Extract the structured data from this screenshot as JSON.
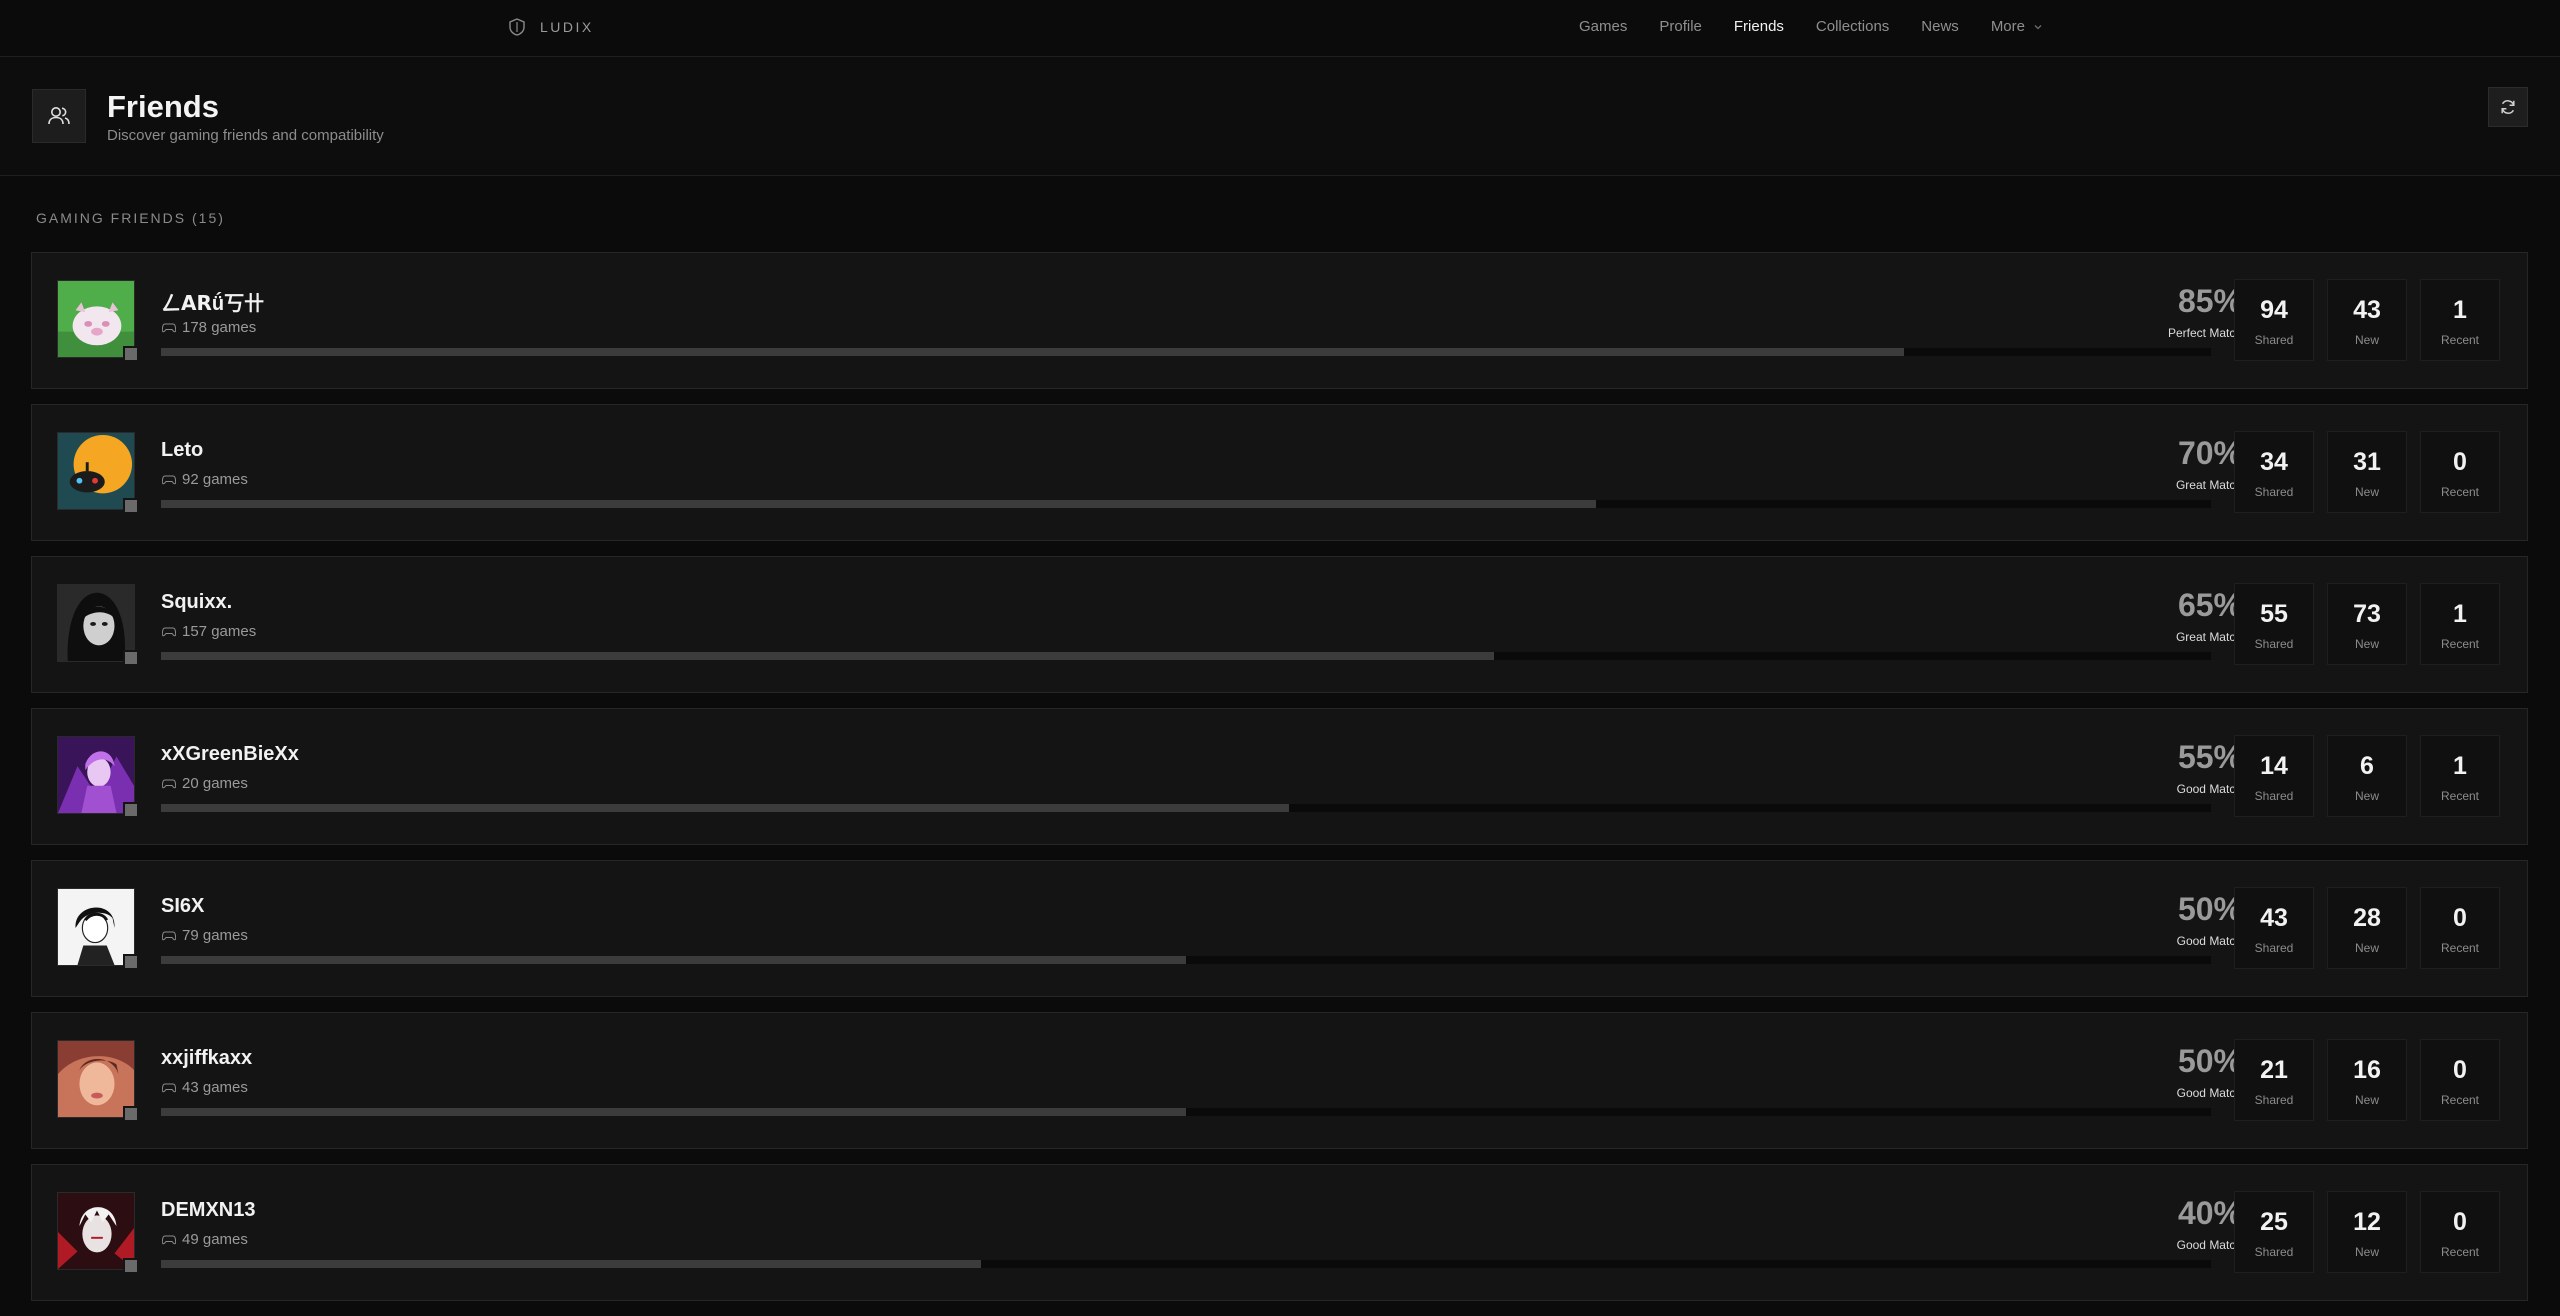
{
  "nav": {
    "brand": "LUDIX",
    "links": [
      "Games",
      "Profile",
      "Friends",
      "Collections",
      "News"
    ],
    "active": "Friends",
    "more_label": "More"
  },
  "header": {
    "title": "Friends",
    "subtitle": "Discover gaming friends and compatibility"
  },
  "section": {
    "title": "GAMING FRIENDS (15)"
  },
  "stat_labels": {
    "shared": "Shared",
    "new": "New",
    "recent": "Recent"
  },
  "friends": [
    {
      "name": "ㄥ𝗔𝗥ǘ丂卄",
      "games": "178 games",
      "match_pct": "85%",
      "match_label": "Perfect Match",
      "match_fraction": 0.85,
      "shared": "94",
      "new": "43",
      "recent": "1"
    },
    {
      "name": "Leto",
      "games": "92 games",
      "match_pct": "70%",
      "match_label": "Great Match",
      "match_fraction": 0.7,
      "shared": "34",
      "new": "31",
      "recent": "0"
    },
    {
      "name": "Squixx.",
      "games": "157 games",
      "match_pct": "65%",
      "match_label": "Great Match",
      "match_fraction": 0.65,
      "shared": "55",
      "new": "73",
      "recent": "1"
    },
    {
      "name": "xXGreenBieXx",
      "games": "20 games",
      "match_pct": "55%",
      "match_label": "Good Match",
      "match_fraction": 0.55,
      "shared": "14",
      "new": "6",
      "recent": "1"
    },
    {
      "name": "SI6X",
      "games": "79 games",
      "match_pct": "50%",
      "match_label": "Good Match",
      "match_fraction": 0.5,
      "shared": "43",
      "new": "28",
      "recent": "0"
    },
    {
      "name": "xxjiffkaxx",
      "games": "43 games",
      "match_pct": "50%",
      "match_label": "Good Match",
      "match_fraction": 0.5,
      "shared": "21",
      "new": "16",
      "recent": "0"
    },
    {
      "name": "DEMXN13",
      "games": "49 games",
      "match_pct": "40%",
      "match_label": "Good Match",
      "match_fraction": 0.4,
      "shared": "25",
      "new": "12",
      "recent": "0"
    }
  ]
}
